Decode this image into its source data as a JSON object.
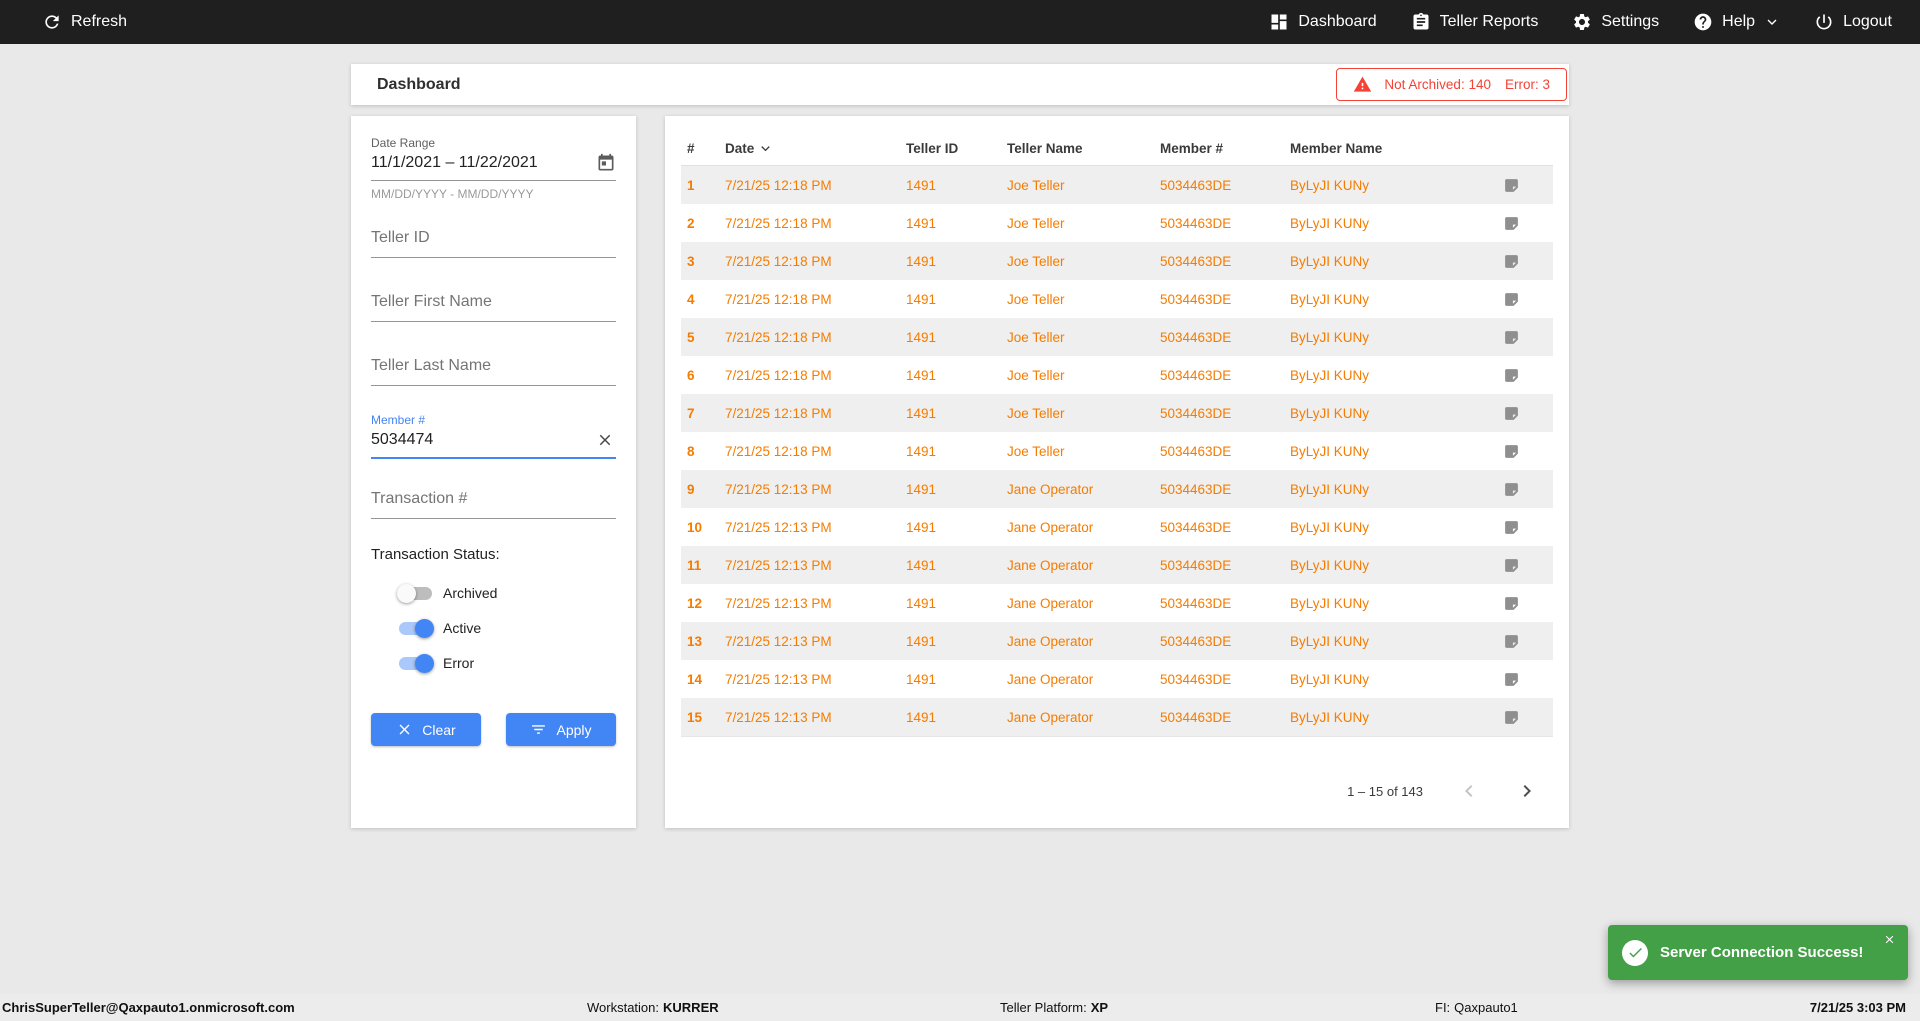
{
  "colors": {
    "accent_blue": "#4285f4",
    "data_orange": "#f57c00",
    "alert_red": "#f44336",
    "success_green": "#43a047",
    "topnav_bg": "#1f1f1f"
  },
  "topnav": {
    "refresh_label": "Refresh",
    "dashboard_label": "Dashboard",
    "teller_reports_label": "Teller Reports",
    "settings_label": "Settings",
    "help_label": "Help",
    "logout_label": "Logout"
  },
  "header": {
    "title": "Dashboard",
    "alert_not_archived": "Not Archived: 140",
    "alert_error": "Error: 3"
  },
  "filters": {
    "date_range_label": "Date Range",
    "date_range_value": "11/1/2021 – 11/22/2021",
    "date_range_hint": "MM/DD/YYYY - MM/DD/YYYY",
    "teller_id_placeholder": "Teller ID",
    "teller_first_name_placeholder": "Teller First Name",
    "teller_last_name_placeholder": "Teller Last Name",
    "member_number_label": "Member #",
    "member_number_value": "5034474",
    "transaction_placeholder": "Transaction #",
    "status_label": "Transaction Status:",
    "toggles": [
      {
        "label": "Archived",
        "on": false
      },
      {
        "label": "Active",
        "on": true
      },
      {
        "label": "Error",
        "on": true
      }
    ],
    "clear_label": "Clear",
    "apply_label": "Apply"
  },
  "table": {
    "columns": [
      "#",
      "Date",
      "Teller ID",
      "Teller Name",
      "Member #",
      "Member Name"
    ],
    "rows": [
      {
        "num": "1",
        "date": "7/21/25 12:18 PM",
        "teller_id": "1491",
        "teller_name": "Joe Teller",
        "member_num": "5034463DE",
        "member_name": "ByLyJI KUNy"
      },
      {
        "num": "2",
        "date": "7/21/25 12:18 PM",
        "teller_id": "1491",
        "teller_name": "Joe Teller",
        "member_num": "5034463DE",
        "member_name": "ByLyJI KUNy"
      },
      {
        "num": "3",
        "date": "7/21/25 12:18 PM",
        "teller_id": "1491",
        "teller_name": "Joe Teller",
        "member_num": "5034463DE",
        "member_name": "ByLyJI KUNy"
      },
      {
        "num": "4",
        "date": "7/21/25 12:18 PM",
        "teller_id": "1491",
        "teller_name": "Joe Teller",
        "member_num": "5034463DE",
        "member_name": "ByLyJI KUNy"
      },
      {
        "num": "5",
        "date": "7/21/25 12:18 PM",
        "teller_id": "1491",
        "teller_name": "Joe Teller",
        "member_num": "5034463DE",
        "member_name": "ByLyJI KUNy"
      },
      {
        "num": "6",
        "date": "7/21/25 12:18 PM",
        "teller_id": "1491",
        "teller_name": "Joe Teller",
        "member_num": "5034463DE",
        "member_name": "ByLyJI KUNy"
      },
      {
        "num": "7",
        "date": "7/21/25 12:18 PM",
        "teller_id": "1491",
        "teller_name": "Joe Teller",
        "member_num": "5034463DE",
        "member_name": "ByLyJI KUNy"
      },
      {
        "num": "8",
        "date": "7/21/25 12:18 PM",
        "teller_id": "1491",
        "teller_name": "Joe Teller",
        "member_num": "5034463DE",
        "member_name": "ByLyJI KUNy"
      },
      {
        "num": "9",
        "date": "7/21/25 12:13 PM",
        "teller_id": "1491",
        "teller_name": "Jane Operator",
        "member_num": "5034463DE",
        "member_name": "ByLyJI KUNy"
      },
      {
        "num": "10",
        "date": "7/21/25 12:13 PM",
        "teller_id": "1491",
        "teller_name": "Jane Operator",
        "member_num": "5034463DE",
        "member_name": "ByLyJI KUNy"
      },
      {
        "num": "11",
        "date": "7/21/25 12:13 PM",
        "teller_id": "1491",
        "teller_name": "Jane Operator",
        "member_num": "5034463DE",
        "member_name": "ByLyJI KUNy"
      },
      {
        "num": "12",
        "date": "7/21/25 12:13 PM",
        "teller_id": "1491",
        "teller_name": "Jane Operator",
        "member_num": "5034463DE",
        "member_name": "ByLyJI KUNy"
      },
      {
        "num": "13",
        "date": "7/21/25 12:13 PM",
        "teller_id": "1491",
        "teller_name": "Jane Operator",
        "member_num": "5034463DE",
        "member_name": "ByLyJI KUNy"
      },
      {
        "num": "14",
        "date": "7/21/25 12:13 PM",
        "teller_id": "1491",
        "teller_name": "Jane Operator",
        "member_num": "5034463DE",
        "member_name": "ByLyJI KUNy"
      },
      {
        "num": "15",
        "date": "7/21/25 12:13 PM",
        "teller_id": "1491",
        "teller_name": "Jane Operator",
        "member_num": "5034463DE",
        "member_name": "ByLyJI KUNy"
      }
    ],
    "pagination_range": "1 – 15 of 143"
  },
  "toast": {
    "message": "Server Connection Success!"
  },
  "statusbar": {
    "user": "ChrisSuperTeller@Qaxpauto1.onmicrosoft.com",
    "workstation_label": "Workstation:",
    "workstation_value": "KURRER",
    "platform_label": "Teller Platform:",
    "platform_value": "XP",
    "fi_label": "FI:",
    "fi_value": "Qaxpauto1",
    "datetime": "7/21/25 3:03 PM"
  }
}
